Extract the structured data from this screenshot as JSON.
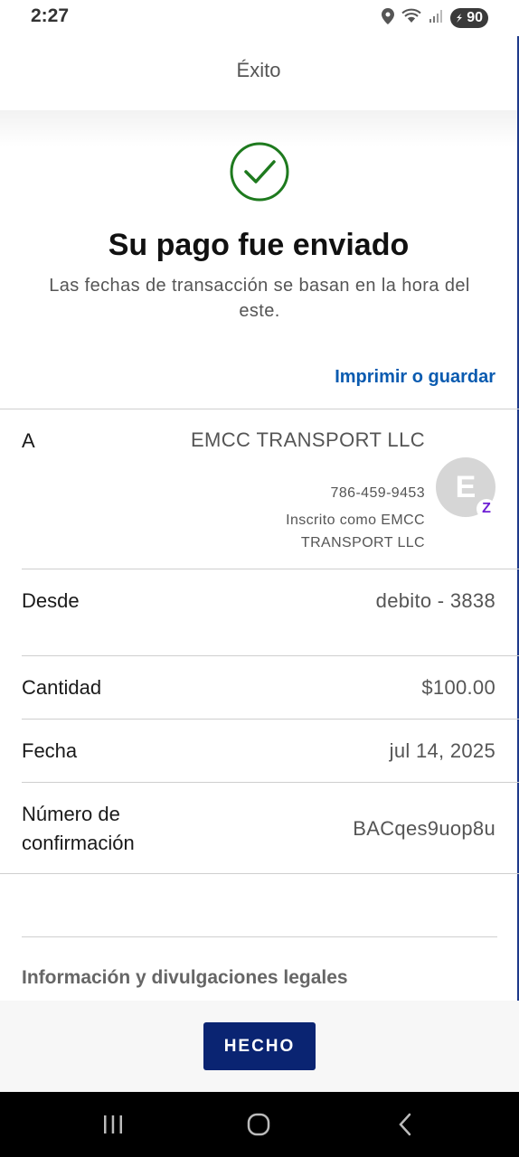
{
  "status_bar": {
    "time": "2:27",
    "battery": "90",
    "icons": [
      "location-icon",
      "wifi-icon",
      "signal-icon",
      "battery-icon"
    ]
  },
  "header": {
    "title": "Éxito"
  },
  "success": {
    "icon": "checkmark-circle-icon",
    "title": "Su pago fue enviado",
    "subtitle": "Las fechas de transacción se basan en la hora del este.",
    "print_link": "Imprimir o guardar"
  },
  "details": {
    "to": {
      "label": "A",
      "name": "EMCC TRANSPORT LLC",
      "phone": "786-459-9453",
      "enrolled": "Inscrito como EMCC TRANSPORT LLC",
      "avatar_letter": "E",
      "badge": "Z"
    },
    "from": {
      "label": "Desde",
      "value": "debito - 3838"
    },
    "amount": {
      "label": "Cantidad",
      "value": "$100.00"
    },
    "date": {
      "label": "Fecha",
      "value": "jul 14, 2025"
    },
    "confirmation": {
      "label": "Número de confirmación",
      "value": "BACqes9uop8u"
    }
  },
  "legal": {
    "title": "Información y divulgaciones legales"
  },
  "footer": {
    "done_label": "HECHO"
  },
  "colors": {
    "accent": "#0a2472",
    "link": "#0a5bb0",
    "success_green": "#1e7a1e",
    "zelle_purple": "#6d1ed4"
  },
  "nav": [
    "recents-icon",
    "home-icon",
    "back-icon"
  ]
}
